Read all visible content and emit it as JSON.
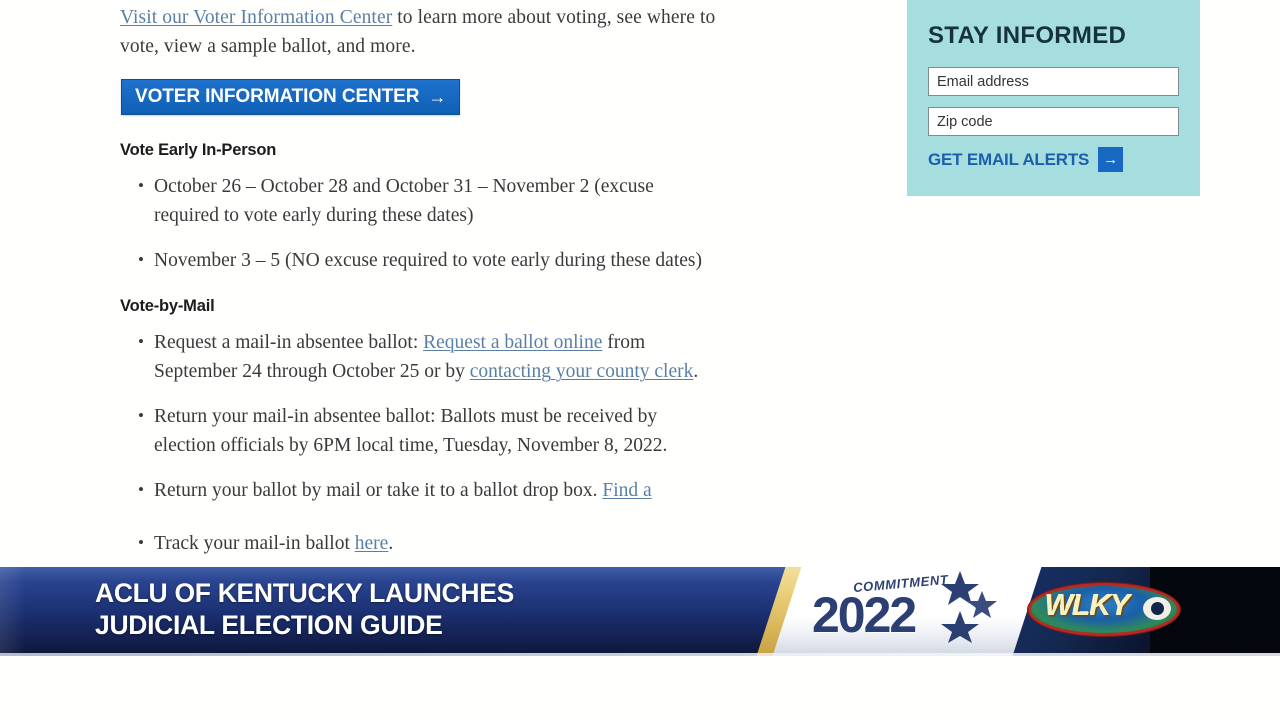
{
  "page": {
    "intro": {
      "link_text": "Visit our Voter Information Center",
      "rest": " to learn more about voting, see where to vote, view a sample ballot, and more."
    },
    "cta_button": {
      "label": "VOTER INFORMATION CENTER",
      "arrow": "→"
    },
    "sections": [
      {
        "heading": "Vote Early In-Person",
        "items": [
          "October 26 – October 28 and October 31 – November 2 (excuse required to vote early during these dates)",
          "November 3 – 5 (NO excuse required to vote early during these dates)"
        ]
      }
    ],
    "vote_by_mail": {
      "heading": "Vote-by-Mail",
      "item1_pre": "Request a mail-in absentee ballot: ",
      "item1_link1": "Request a ballot online",
      "item1_mid": " from September 24 through October 25 or by ",
      "item1_link2": "contacting your county clerk",
      "item1_post": ".",
      "item2": "Return your mail-in absentee ballot: Ballots must be received by election officials by 6PM local time, Tuesday, November 8, 2022.",
      "item3_pre": "Return your ballot by mail or take it to a ballot drop box. ",
      "item3_link": "Find a",
      "item4_pre": "Track your mail-in ballot ",
      "item4_link": "here",
      "item4_post": "."
    }
  },
  "sidebar": {
    "title": "STAY INFORMED",
    "email_placeholder": "Email address",
    "email_value": "",
    "zip_placeholder": "Zip code",
    "zip_value": "",
    "cta_label": "GET EMAIL ALERTS",
    "cta_arrow": "→",
    "bg_color": "#a6dee0",
    "accent_color": "#1668c2"
  },
  "lower_third": {
    "headline_line1": "ACLU OF KENTUCKY LAUNCHES",
    "headline_line2": "JUDICIAL ELECTION GUIDE",
    "commitment_word": "COMMITMENT",
    "commitment_year": "2022",
    "station_call_letters": "WLKY",
    "banner_color": "#1b3071",
    "gold_color": "#e3c46a"
  }
}
